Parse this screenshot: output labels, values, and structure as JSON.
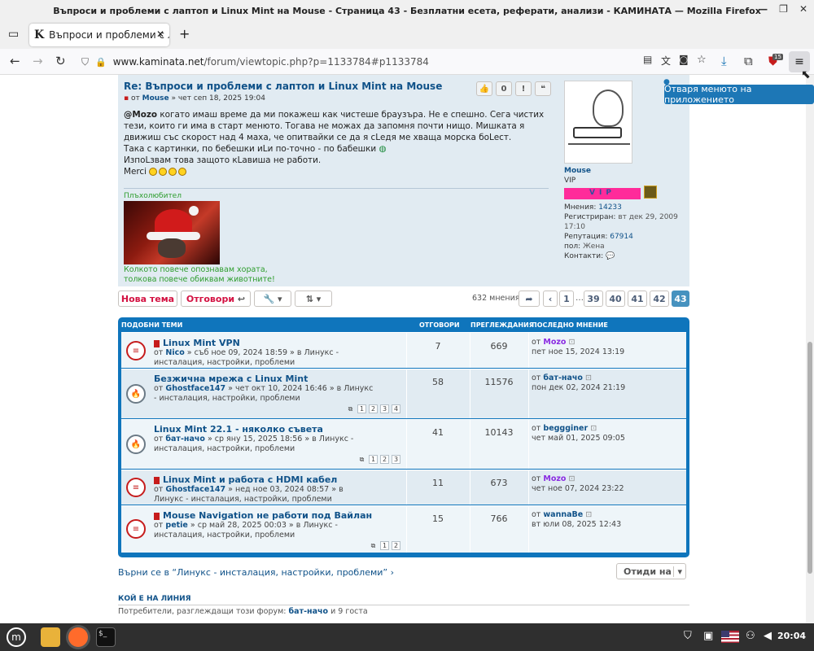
{
  "window": {
    "title": "Въпроси и проблеми с лаптоп и Linux Mint на Mouse - Страница 43 - Безплатни есета, реферати, анализи - КАМИНАТА — Mozilla Firefox"
  },
  "tab": {
    "title": "Въпроси и проблеми с лаптоп",
    "favicon": "K",
    "close": "✕",
    "new": "+"
  },
  "nav": {
    "url_domain": "www.kaminata.net",
    "url_path": "/forum/viewtopic.php?p=1133784#p1133784",
    "badge": "15"
  },
  "tooltip": "Отваря менюто на приложението",
  "post": {
    "title": "Re: Въпроси и проблеми с лаптоп и Linux Mint на Mouse",
    "meta_prefix": "от",
    "author": "Mouse",
    "meta_date": "» чет сеп 18, 2025 19:04",
    "like_count": "0",
    "body_mention": "@Mozo",
    "body_line1": " когато имаш време да ми покажеш как чистеше браузъра. Не е спешно. Сега чистих тези, които ги има в старт менюто. Тогава не можах да запомня почти нищо. Мишката я движиш със скорост над 4 маха, че опитвайки се да я cLедя ме хваща морска боLест.",
    "body_line2": "Така с картинки, по бебешки иLи по-точно - по бабешки",
    "body_line3": "ИзпоLзвам това защото кLавишa не работи.",
    "body_line4": "Merci",
    "sig_top": "Плъхолюбител",
    "sig_line1": "Колкото повече опознавам хората,",
    "sig_line2": "толкова повече обиквам животните!"
  },
  "profile": {
    "name": "Mouse",
    "role": "VIP",
    "vip_badge": "VIP",
    "posts_label": "Мнения:",
    "posts": "14233",
    "reg_label": "Регистриран:",
    "reg": "вт дек 29, 2009 17:10",
    "rep_label": "Репутация:",
    "rep": "67914",
    "sex_label": "пол:",
    "sex": "Жена",
    "contacts_label": "Контакти:"
  },
  "actions": {
    "new_topic": "Нова тема",
    "reply": "Отговори",
    "posts_count": "632 мнения",
    "pages": [
      "1",
      "…",
      "39",
      "40",
      "41",
      "42",
      "43"
    ]
  },
  "similar": {
    "header": "ПОДОБНИ ТЕМИ",
    "col_replies": "ОТГОВОРИ",
    "col_views": "ПРЕГЛЕЖДАНИЯ",
    "col_last": "ПОСЛЕДНО МНЕНИЕ",
    "rows": [
      {
        "title": "Linux Mint VPN",
        "by": "от",
        "author": "Nico",
        "date": "» съб ное 09, 2024 18:59 » в Линукс - инсталация, настройки, проблеми",
        "replies": "7",
        "views": "669",
        "last_by": "от",
        "last_user": "Mozo",
        "last_date": "пет ное 15, 2024 13:19"
      },
      {
        "title": "Безжична мрежа с Linux Mint",
        "by": "от",
        "author": "Ghostface147",
        "date": "» чет окт 10, 2024 16:46 » в Линукс - инсталация, настройки, проблеми",
        "replies": "58",
        "views": "11576",
        "last_by": "от",
        "last_user": "бат-начо",
        "last_date": "пон дек 02, 2024 21:19",
        "pages": [
          "1",
          "2",
          "3",
          "4"
        ]
      },
      {
        "title": "Linux Mint 22.1 - няколко съвета",
        "by": "от",
        "author": "бат-начо",
        "date": "» ср яну 15, 2025 18:56 » в Линукс - инсталация, настройки, проблеми",
        "replies": "41",
        "views": "10143",
        "last_by": "от",
        "last_user": "beggginer",
        "last_date": "чет май 01, 2025 09:05",
        "pages": [
          "1",
          "2",
          "3"
        ]
      },
      {
        "title": "Linux Mint и работа с HDMI кабел",
        "by": "от",
        "author": "Ghostface147",
        "date": "» нед ное 03, 2024 08:57 » в Линукс - инсталация, настройки, проблеми",
        "replies": "11",
        "views": "673",
        "last_by": "от",
        "last_user": "Mozo",
        "last_date": "чет ное 07, 2024 23:22"
      },
      {
        "title": "Mouse Navigation не работи под Вайлан",
        "by": "от",
        "author": "petie",
        "date": "» ср май 28, 2025 00:03 » в Линукс - инсталация, настройки, проблеми",
        "replies": "15",
        "views": "766",
        "last_by": "от",
        "last_user": "wannaBe",
        "last_date": "вт юли 08, 2025 12:43",
        "pages": [
          "1",
          "2"
        ]
      }
    ]
  },
  "footer": {
    "jump_back": "Върни се в “Линукс - инсталация, настройки, проблеми”",
    "goto": "Отиди на",
    "online_header": "КОЙ Е НА ЛИНИЯ",
    "online_text": "Потребители, разглеждащи този форум:",
    "online_user": "бат-начо",
    "online_guests": "и 9 госта"
  },
  "taskbar": {
    "clock": "20:04"
  },
  "colors": {
    "accent": "#105289",
    "red": "#d31141",
    "vip": "#ff2b9a",
    "mozo": "#8a2be2",
    "green": "#2d9d2d"
  }
}
